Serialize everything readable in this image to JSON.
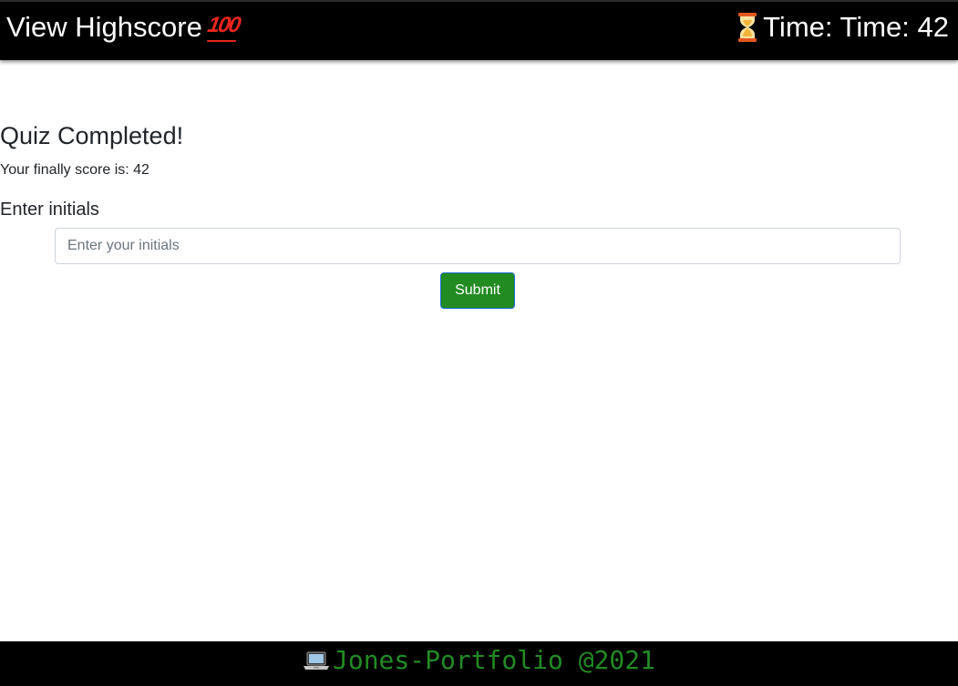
{
  "header": {
    "highscore_label": "View Highscore",
    "highscore_icon": "hundred-points-icon",
    "timer_icon": "hourglass-icon",
    "timer_label": "Time: Time: 42"
  },
  "quiz": {
    "title": "Quiz Completed!",
    "score_text": "Your finally score is: 42",
    "initials_label": "Enter initials",
    "initials_placeholder": "Enter your initials",
    "initials_value": "",
    "submit_label": "Submit"
  },
  "footer": {
    "icon": "laptop-icon",
    "text": "Jones-Portfolio @2021"
  },
  "colors": {
    "header_bg": "#000000",
    "header_text": "#ffffff",
    "submit_bg": "#228b22",
    "footer_text": "#228b22",
    "hundred_red": "#e8261e"
  }
}
